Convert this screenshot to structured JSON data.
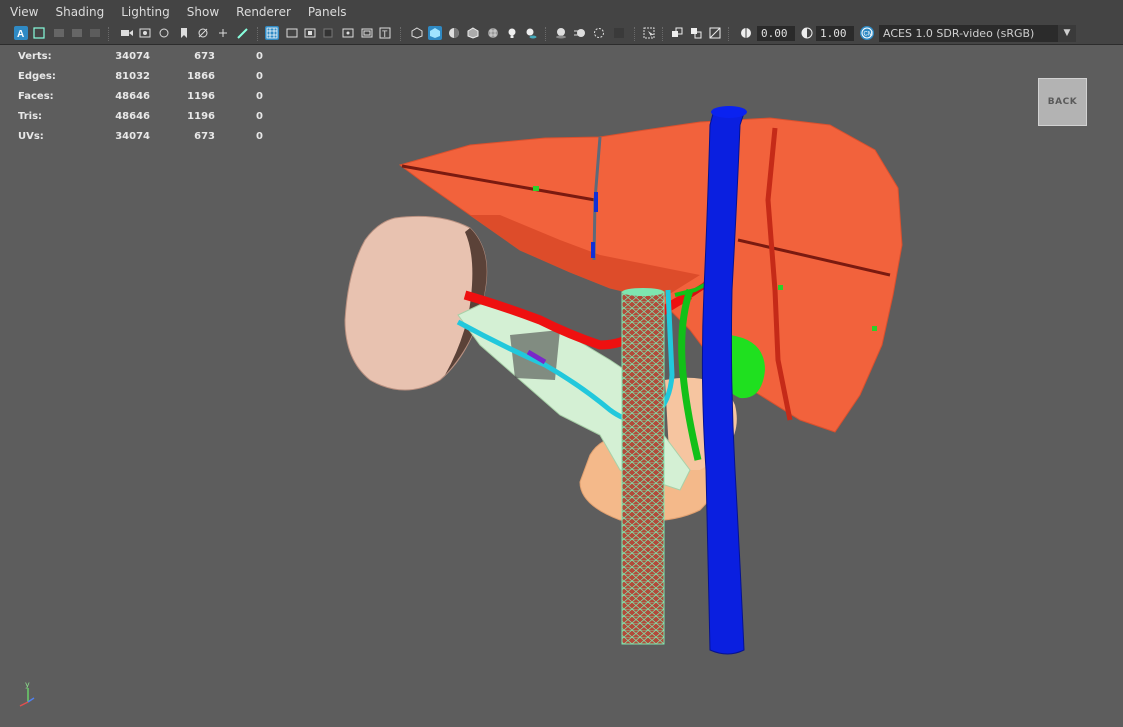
{
  "menu": [
    "View",
    "Shading",
    "Lighting",
    "Show",
    "Renderer",
    "Panels"
  ],
  "toolbar": {
    "exposure_value": "0.00",
    "gamma_value": "1.00",
    "color_space": "ACES 1.0 SDR-video (sRGB)",
    "accent_color": "#2f8ac4"
  },
  "hud": {
    "rows": [
      {
        "label": "Verts:",
        "v1": "34074",
        "v2": "673",
        "v3": "0"
      },
      {
        "label": "Edges:",
        "v1": "81032",
        "v2": "1866",
        "v3": "0"
      },
      {
        "label": "Faces:",
        "v1": "48646",
        "v2": "1196",
        "v3": "0"
      },
      {
        "label": "Tris:",
        "v1": "48646",
        "v2": "1196",
        "v3": "0"
      },
      {
        "label": "UVs:",
        "v1": "34074",
        "v2": "673",
        "v3": "0"
      }
    ]
  },
  "viewport": {
    "back_label": "BACK",
    "background_color": "#5d5d5d",
    "axis_label_y": "y",
    "objects": [
      {
        "name": "liver",
        "color": "#f2623c"
      },
      {
        "name": "spleen",
        "color": "#e8c2b0"
      },
      {
        "name": "inferior-vena-cava",
        "color": "#0a1fe0"
      },
      {
        "name": "aorta-wireframe",
        "color": "#b44a3a"
      },
      {
        "name": "gallbladder",
        "color": "#1fe01f"
      },
      {
        "name": "pancreas",
        "color": "#f4b98a"
      },
      {
        "name": "splenic-artery",
        "color": "#ee1010"
      },
      {
        "name": "splenic-vein",
        "color": "#22c8dc"
      }
    ]
  }
}
